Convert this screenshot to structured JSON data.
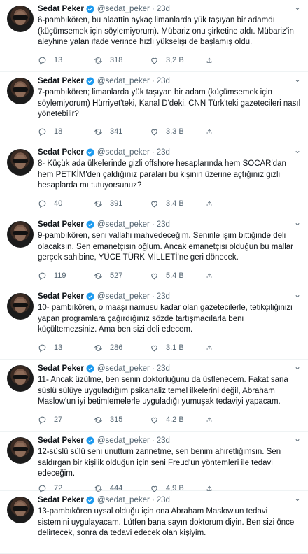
{
  "author": {
    "name": "Sedat Peker",
    "handle": "@sedat_peker",
    "time": "23d",
    "sep": "·"
  },
  "colors": {
    "verified": "#1d9bf0",
    "muted": "#536471",
    "text": "#0f1419"
  },
  "tweets": [
    {
      "text": "6-pambıkören, bu alaattin aykaç limanlarda yük taşıyan bir adamdı (küçümsemek için söylemiyorum). Mübariz onu şirketine aldı. Mübariz'in aleyhine yalan ifade verince hızlı yükselişi de başlamış oldu.",
      "replies": "13",
      "retweets": "318",
      "likes": "3,2 B"
    },
    {
      "text": "7-pambıkören; limanlarda yük taşıyan bir adam (küçümsemek için söylemiyorum) Hürriyet'teki, Kanal D'deki, CNN Türk'teki gazetecileri nasıl yönetebilir?",
      "replies": "18",
      "retweets": "341",
      "likes": "3,3 B"
    },
    {
      "text": "8- Küçük ada ülkelerinde gizli offshore hesaplarında hem SOCAR'dan hem PETKİM'den çaldığınız paraları bu kişinin üzerine açtığınız gizli hesaplarda mı tutuyorsunuz?",
      "replies": "40",
      "retweets": "391",
      "likes": "3,4 B"
    },
    {
      "text": "9-pambıkören, seni vallahi mahvedeceğim. Seninle işim bittiğinde deli olacaksın. Sen emanetçisin oğlum. Ancak emanetçisi olduğun bu mallar gerçek sahibine, YÜCE TÜRK MİLLETİ'ne geri dönecek.",
      "replies": "119",
      "retweets": "527",
      "likes": "5,4 B"
    },
    {
      "text": "10- pambıkören, o maaşı namusu kadar olan gazetecilerle, tetikçiliğinizi yapan programlara çağırdığınız sözde tartışmacılarla beni küçültemezsiniz. Ama ben sizi deli edecem.",
      "replies": "13",
      "retweets": "286",
      "likes": "3,1 B"
    },
    {
      "text": "11- Ancak üzülme, ben senin doktorluğunu da üstlenecem. Fakat sana süslü sülüye uyguladığım psikanaliz temel ilkelerini değil, Abraham Maslow'un iyi betimlemelerle uyguladığı yumuşak tedaviyi yapacam.",
      "replies": "27",
      "retweets": "315",
      "likes": "4,2 B"
    },
    {
      "text": "12-süslü sülü seni unuttum zannetme, sen benim ahiretliğimsin. Sen saldırgan bir kişilik olduğun için seni Freud'un yöntemleri ile tedavi edeceğim.",
      "replies": "72",
      "retweets": "444",
      "likes": "4,9 B"
    },
    {
      "text": "13-pambıkören uysal olduğu için ona Abraham Maslow'un tedavi sistemini uygulayacam. Lütfen bana sayın doktorum diyin. Ben sizi önce delirtecek, sonra da tedavi edecek olan kişiyim."
    }
  ]
}
